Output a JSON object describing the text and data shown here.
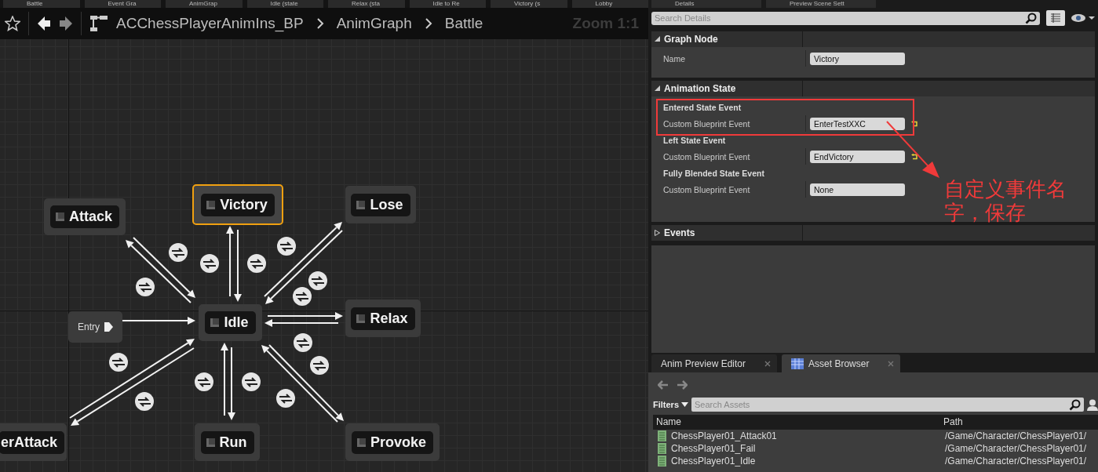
{
  "doc_tabs": [
    {
      "label": "Battle"
    },
    {
      "label": "Event Gra"
    },
    {
      "label": "AnimGrap"
    },
    {
      "label": "Idle (state"
    },
    {
      "label": "Relax (sta"
    },
    {
      "label": "Idle to Re"
    },
    {
      "label": "Victory (s"
    },
    {
      "label": "Lobby"
    }
  ],
  "breadcrumb": {
    "items": [
      "ACChessPlayerAnimIns_BP",
      "AnimGraph",
      "Battle"
    ],
    "zoom": "Zoom 1:1"
  },
  "graph": {
    "nodes": [
      {
        "label": "Attack",
        "kind": "state",
        "selected": false
      },
      {
        "label": "Victory",
        "kind": "state",
        "selected": true
      },
      {
        "label": "Lose",
        "kind": "state",
        "selected": false
      },
      {
        "label": "Entry",
        "kind": "entry",
        "selected": false
      },
      {
        "label": "Idle",
        "kind": "state",
        "selected": false
      },
      {
        "label": "Relax",
        "kind": "state",
        "selected": false
      },
      {
        "label": "erAttack",
        "kind": "state",
        "selected": false
      },
      {
        "label": "Run",
        "kind": "state",
        "selected": false
      },
      {
        "label": "Provoke",
        "kind": "state",
        "selected": false
      }
    ]
  },
  "details": {
    "tabs": [
      {
        "label": "Details"
      },
      {
        "label": "Preview Scene Sett"
      }
    ],
    "search": {
      "placeholder": "Search Details"
    },
    "sections": [
      {
        "title": "Graph Node",
        "expanded": true,
        "rows": [
          {
            "kind": "property",
            "label": "Name",
            "value": "Victory",
            "reset": false
          }
        ]
      },
      {
        "title": "Animation State",
        "expanded": true,
        "rows": [
          {
            "kind": "heading",
            "label": "Entered State Event"
          },
          {
            "kind": "property",
            "label": "Custom Blueprint Event",
            "value": "EnterTestXXC",
            "reset": true
          },
          {
            "kind": "heading",
            "label": "Left State Event"
          },
          {
            "kind": "property",
            "label": "Custom Blueprint Event",
            "value": "EndVictory",
            "reset": true
          },
          {
            "kind": "heading",
            "label": "Fully Blended State Event"
          },
          {
            "kind": "property",
            "label": "Custom Blueprint Event",
            "value": "None",
            "reset": false
          }
        ]
      },
      {
        "title": "Events",
        "expanded": false
      }
    ]
  },
  "annotation": {
    "note": "自定义事件名字，保存"
  },
  "asset_panel": {
    "tabs": [
      {
        "label": "Anim Preview Editor",
        "selected": false
      },
      {
        "label": "Asset Browser",
        "selected": true
      }
    ],
    "filters": "Filters",
    "search": {
      "placeholder": "Search Assets"
    },
    "columns": [
      "Name",
      "Path"
    ],
    "rows": [
      {
        "name": "ChessPlayer01_Attack01",
        "path": "/Game/Character/ChessPlayer01/"
      },
      {
        "name": "ChessPlayer01_Fail",
        "path": "/Game/Character/ChessPlayer01/"
      },
      {
        "name": "ChessPlayer01_Idle",
        "path": "/Game/Character/ChessPlayer01/"
      }
    ]
  }
}
